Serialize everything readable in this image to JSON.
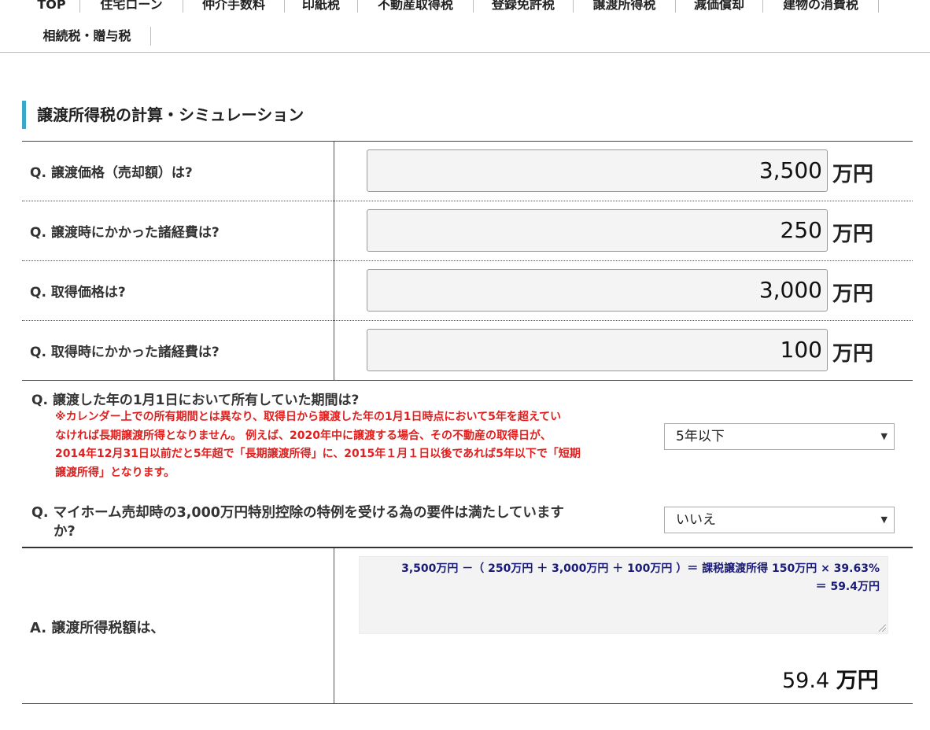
{
  "nav": {
    "items_row1": [
      "TOP",
      "住宅ローン",
      "仲介手数料",
      "印紙税",
      "不動産取得税",
      "登録免許税",
      "譲渡所得税",
      "減価償却",
      "建物の消費税"
    ],
    "items_row2": [
      "相続税・贈与税"
    ]
  },
  "section_title": "譲渡所得税の計算・シミュレーション",
  "questions": [
    {
      "label": "Q. 譲渡価格（売却額）は?",
      "value": "3,500",
      "unit": "万円"
    },
    {
      "label": "Q. 譲渡時にかかった諸経費は?",
      "value": "250",
      "unit": "万円"
    },
    {
      "label": "Q. 取得価格は?",
      "value": "3,000",
      "unit": "万円"
    },
    {
      "label": "Q. 取得時にかかった諸経費は?",
      "value": "100",
      "unit": "万円"
    }
  ],
  "period_question": {
    "label": "Q. 譲渡した年の1月1日において所有していた期間は?",
    "note_lines": [
      "※カレンダー上での所有期間とは異なり、取得日から譲渡した年の1月1日時点において5年を超えてい",
      "なければ長期譲渡所得となりません。 例えば、2020年中に譲渡する場合、その不動産の取得日が、",
      "2014年12月31日以前だと5年超で「長期譲渡所得」に、2015年１月１日以後であれば5年以下で「短期",
      "譲渡所得」となります。"
    ],
    "selected": "5年以下"
  },
  "myhome_question": {
    "label_line1": "Q. マイホーム売却時の3,000万円特別控除の特例を受ける為の要件は満たしていますか?",
    "label_line2": "か?",
    "selected": "いいえ"
  },
  "answer": {
    "label": "A. 譲渡所得税額は、",
    "formula_line1": "3,500万円 －（ 250万円 ＋ 3,000万円 ＋ 100万円 ）＝ 課税譲渡所得 150万円 × 39.63%",
    "formula_line2": "＝ 59.4万円",
    "value": "59.4",
    "unit": "万円"
  },
  "colors": {
    "accent": "#3aa8c9",
    "note": "#e0201e",
    "formula": "#1a1a7a"
  }
}
